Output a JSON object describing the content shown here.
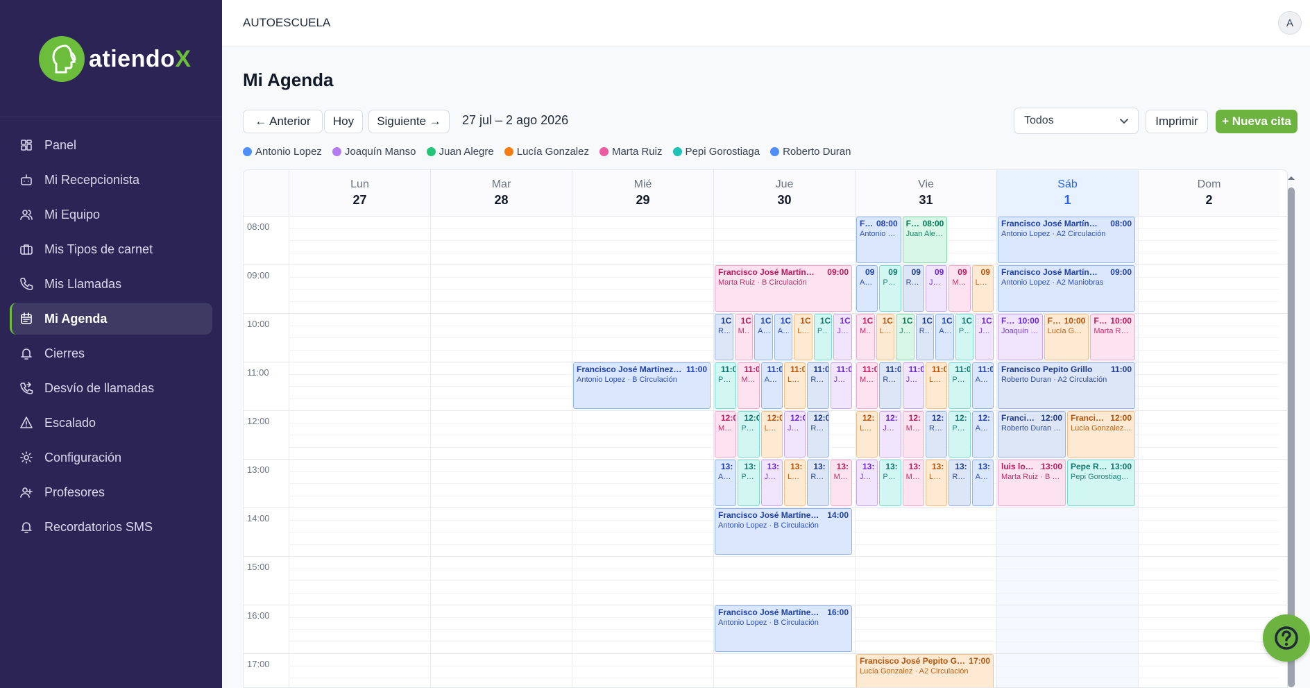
{
  "brand": {
    "name": "atiendo",
    "x": "X",
    "color": "#6cbd3c"
  },
  "sidebar": {
    "items": [
      {
        "label": "Panel",
        "icon": "dashboard-icon"
      },
      {
        "label": "Mi Recepcionista",
        "icon": "robot-icon"
      },
      {
        "label": "Mi Equipo",
        "icon": "users-icon"
      },
      {
        "label": "Mis Tipos de carnet",
        "icon": "briefcase-icon"
      },
      {
        "label": "Mis Llamadas",
        "icon": "phone-icon"
      },
      {
        "label": "Mi Agenda",
        "icon": "calendar-icon",
        "active": true
      },
      {
        "label": "Cierres",
        "icon": "bell-icon"
      },
      {
        "label": "Desvío de llamadas",
        "icon": "phone-forward-icon"
      },
      {
        "label": "Escalado",
        "icon": "warning-icon"
      },
      {
        "label": "Configuración",
        "icon": "gear-icon"
      },
      {
        "label": "Profesores",
        "icon": "user-plus-icon"
      },
      {
        "label": "Recordatorios SMS",
        "icon": "bell-icon"
      }
    ]
  },
  "topbar": {
    "title": "AUTOESCUELA",
    "avatar": "A"
  },
  "page": {
    "title": "Mi Agenda"
  },
  "toolbar": {
    "prev": "← Anterior",
    "today": "Hoy",
    "next": "Siguiente →",
    "range": "27 jul – 2 ago 2026",
    "filter": "Todos",
    "print": "Imprimir",
    "new": "+ Nueva cita"
  },
  "legend": [
    {
      "name": "Antonio Lopez",
      "color": "#4f8ef7"
    },
    {
      "name": "Joaquín Manso",
      "color": "#b57bf0"
    },
    {
      "name": "Juan Alegre",
      "color": "#22c57a"
    },
    {
      "name": "Lucía Gonzalez",
      "color": "#f47c13"
    },
    {
      "name": "Marta Ruiz",
      "color": "#ec5ba2"
    },
    {
      "name": "Pepi Gorostiaga",
      "color": "#1ec2b4"
    },
    {
      "name": "Roberto Duran",
      "color": "#4f8ef7"
    }
  ],
  "teacher_colors": {
    "AL": {
      "bg": "#dbe7fd",
      "bd": "#8fb4f4",
      "tx": "#1e40af"
    },
    "JM": {
      "bg": "#f0e5fd",
      "bd": "#c9a6f3",
      "tx": "#6d28d9"
    },
    "JA": {
      "bg": "#d8f7e6",
      "bd": "#7fdcab",
      "tx": "#047857"
    },
    "LG": {
      "bg": "#feead3",
      "bd": "#f6bd85",
      "tx": "#b45309"
    },
    "MR": {
      "bg": "#fde2ef",
      "bd": "#f3a7cd",
      "tx": "#be185d"
    },
    "PG": {
      "bg": "#d2f6f1",
      "bd": "#76dccf",
      "tx": "#0f766e"
    },
    "RD": {
      "bg": "#dde6f7",
      "bd": "#9cb3e2",
      "tx": "#1e3a8a"
    }
  },
  "calendar": {
    "days": [
      {
        "name": "Lun",
        "num": "27"
      },
      {
        "name": "Mar",
        "num": "28"
      },
      {
        "name": "Mié",
        "num": "29"
      },
      {
        "name": "Jue",
        "num": "30"
      },
      {
        "name": "Vie",
        "num": "31"
      },
      {
        "name": "Sáb",
        "num": "1",
        "today": true
      },
      {
        "name": "Dom",
        "num": "2"
      }
    ],
    "hours": [
      "08:00",
      "09:00",
      "10:00",
      "11:00",
      "12:00",
      "13:00",
      "14:00",
      "15:00",
      "16:00",
      "17:00"
    ],
    "events": [
      {
        "day": 4,
        "start": 8,
        "dur": 1,
        "col": 0,
        "ncol": 3,
        "t": "AL",
        "title": "Franci…",
        "time": "08:00",
        "sub": "Antonio Lopez ·…"
      },
      {
        "day": 4,
        "start": 8,
        "dur": 1,
        "col": 1,
        "ncol": 3,
        "t": "JA",
        "title": "Franci…",
        "time": "08:00",
        "sub": "Juan Alegre · A…"
      },
      {
        "day": 5,
        "start": 8,
        "dur": 1,
        "col": 0,
        "ncol": 1,
        "t": "AL",
        "title": "Francisco José Martín…",
        "time": "08:00",
        "sub": "Antonio Lopez · A2 Circulación"
      },
      {
        "day": 3,
        "start": 9,
        "dur": 1,
        "col": 0,
        "ncol": 1,
        "t": "MR",
        "title": "Francisco José Martín…",
        "time": "09:00",
        "sub": "Marta Ruiz · B Circulación"
      },
      {
        "day": 4,
        "start": 9,
        "dur": 1,
        "col": 0,
        "ncol": 6,
        "t": "AL",
        "title": "",
        "time": "09",
        "sub": "A…"
      },
      {
        "day": 4,
        "start": 9,
        "dur": 1,
        "col": 1,
        "ncol": 6,
        "t": "PG",
        "title": "",
        "time": "09",
        "sub": "Pe…"
      },
      {
        "day": 4,
        "start": 9,
        "dur": 1,
        "col": 2,
        "ncol": 6,
        "t": "RD",
        "title": "",
        "time": "09",
        "sub": "Ro…"
      },
      {
        "day": 4,
        "start": 9,
        "dur": 1,
        "col": 3,
        "ncol": 6,
        "t": "JM",
        "title": "",
        "time": "09",
        "sub": "Jo…"
      },
      {
        "day": 4,
        "start": 9,
        "dur": 1,
        "col": 4,
        "ncol": 6,
        "t": "MR",
        "title": "",
        "time": "09",
        "sub": "M…"
      },
      {
        "day": 4,
        "start": 9,
        "dur": 1,
        "col": 5,
        "ncol": 6,
        "t": "LG",
        "title": "",
        "time": "09",
        "sub": "Lu…"
      },
      {
        "day": 5,
        "start": 9,
        "dur": 1,
        "col": 0,
        "ncol": 1,
        "t": "AL",
        "title": "Francisco José Martín…",
        "time": "09:00",
        "sub": "Antonio Lopez · A2 Maniobras"
      },
      {
        "day": 3,
        "start": 10,
        "dur": 1,
        "col": 0,
        "ncol": 7,
        "t": "RD",
        "title": "",
        "time": "1C",
        "sub": "R…"
      },
      {
        "day": 3,
        "start": 10,
        "dur": 1,
        "col": 1,
        "ncol": 7,
        "t": "MR",
        "title": "",
        "time": "1C",
        "sub": "M…"
      },
      {
        "day": 3,
        "start": 10,
        "dur": 1,
        "col": 2,
        "ncol": 7,
        "t": "AL",
        "title": "",
        "time": "1C",
        "sub": "A…"
      },
      {
        "day": 3,
        "start": 10,
        "dur": 1,
        "col": 3,
        "ncol": 7,
        "t": "AL",
        "title": "",
        "time": "1C",
        "sub": "A…"
      },
      {
        "day": 3,
        "start": 10,
        "dur": 1,
        "col": 4,
        "ncol": 7,
        "t": "LG",
        "title": "",
        "time": "1C",
        "sub": "L…"
      },
      {
        "day": 3,
        "start": 10,
        "dur": 1,
        "col": 5,
        "ncol": 7,
        "t": "PG",
        "title": "",
        "time": "1C",
        "sub": "P…"
      },
      {
        "day": 3,
        "start": 10,
        "dur": 1,
        "col": 6,
        "ncol": 7,
        "t": "JM",
        "title": "",
        "time": "1C",
        "sub": "J…"
      },
      {
        "day": 4,
        "start": 10,
        "dur": 1,
        "col": 0,
        "ncol": 7,
        "t": "MR",
        "title": "",
        "time": "1C",
        "sub": "M…"
      },
      {
        "day": 4,
        "start": 10,
        "dur": 1,
        "col": 1,
        "ncol": 7,
        "t": "LG",
        "title": "",
        "time": "1C",
        "sub": "L…"
      },
      {
        "day": 4,
        "start": 10,
        "dur": 1,
        "col": 2,
        "ncol": 7,
        "t": "JA",
        "title": "",
        "time": "1C",
        "sub": "J…"
      },
      {
        "day": 4,
        "start": 10,
        "dur": 1,
        "col": 3,
        "ncol": 7,
        "t": "RD",
        "title": "",
        "time": "1C",
        "sub": "R…"
      },
      {
        "day": 4,
        "start": 10,
        "dur": 1,
        "col": 4,
        "ncol": 7,
        "t": "AL",
        "title": "",
        "time": "1C",
        "sub": "A…"
      },
      {
        "day": 4,
        "start": 10,
        "dur": 1,
        "col": 5,
        "ncol": 7,
        "t": "PG",
        "title": "",
        "time": "1C",
        "sub": "P…"
      },
      {
        "day": 4,
        "start": 10,
        "dur": 1,
        "col": 6,
        "ncol": 7,
        "t": "JM",
        "title": "",
        "time": "1C",
        "sub": "J…"
      },
      {
        "day": 5,
        "start": 10,
        "dur": 1,
        "col": 0,
        "ncol": 3,
        "t": "JM",
        "title": "F…",
        "time": "10:00",
        "sub": "Joaquín …"
      },
      {
        "day": 5,
        "start": 10,
        "dur": 1,
        "col": 1,
        "ncol": 3,
        "t": "LG",
        "title": "F…",
        "time": "10:00",
        "sub": "Lucía Go…"
      },
      {
        "day": 5,
        "start": 10,
        "dur": 1,
        "col": 2,
        "ncol": 3,
        "t": "MR",
        "title": "F…",
        "time": "10:00",
        "sub": "Marta Ru…"
      },
      {
        "day": 2,
        "start": 11,
        "dur": 1,
        "col": 0,
        "ncol": 1,
        "t": "AL",
        "title": "Francisco José Martínez…",
        "time": "11:00",
        "sub": "Antonio Lopez · B Circulación"
      },
      {
        "day": 3,
        "start": 11,
        "dur": 1,
        "col": 0,
        "ncol": 6,
        "t": "PG",
        "title": "",
        "time": "11:0",
        "sub": "Pe…"
      },
      {
        "day": 3,
        "start": 11,
        "dur": 1,
        "col": 1,
        "ncol": 6,
        "t": "MR",
        "title": "",
        "time": "11:0",
        "sub": "M…"
      },
      {
        "day": 3,
        "start": 11,
        "dur": 1,
        "col": 2,
        "ncol": 6,
        "t": "AL",
        "title": "",
        "time": "11:0",
        "sub": "A…"
      },
      {
        "day": 3,
        "start": 11,
        "dur": 1,
        "col": 3,
        "ncol": 6,
        "t": "LG",
        "title": "",
        "time": "11:0",
        "sub": "Lu…"
      },
      {
        "day": 3,
        "start": 11,
        "dur": 1,
        "col": 4,
        "ncol": 6,
        "t": "RD",
        "title": "",
        "time": "11:0",
        "sub": "Ro…"
      },
      {
        "day": 3,
        "start": 11,
        "dur": 1,
        "col": 5,
        "ncol": 6,
        "t": "JM",
        "title": "",
        "time": "11:0",
        "sub": "Jo…"
      },
      {
        "day": 4,
        "start": 11,
        "dur": 1,
        "col": 0,
        "ncol": 6,
        "t": "MR",
        "title": "",
        "time": "11:0",
        "sub": "M…"
      },
      {
        "day": 4,
        "start": 11,
        "dur": 1,
        "col": 1,
        "ncol": 6,
        "t": "RD",
        "title": "",
        "time": "11:0",
        "sub": "Ro…"
      },
      {
        "day": 4,
        "start": 11,
        "dur": 1,
        "col": 2,
        "ncol": 6,
        "t": "JM",
        "title": "",
        "time": "11:0",
        "sub": "Jo…"
      },
      {
        "day": 4,
        "start": 11,
        "dur": 1,
        "col": 3,
        "ncol": 6,
        "t": "LG",
        "title": "",
        "time": "11:0",
        "sub": "Lu…"
      },
      {
        "day": 4,
        "start": 11,
        "dur": 1,
        "col": 4,
        "ncol": 6,
        "t": "PG",
        "title": "",
        "time": "11:0",
        "sub": "Pe…"
      },
      {
        "day": 4,
        "start": 11,
        "dur": 1,
        "col": 5,
        "ncol": 6,
        "t": "AL",
        "title": "",
        "time": "11:0",
        "sub": "A…"
      },
      {
        "day": 5,
        "start": 11,
        "dur": 1,
        "col": 0,
        "ncol": 1,
        "t": "RD",
        "title": "Francisco Pepito Grillo",
        "time": "11:00",
        "sub": "Roberto Duran · A2 Circulación"
      },
      {
        "day": 3,
        "start": 12,
        "dur": 1,
        "col": 0,
        "ncol": 6,
        "t": "MR",
        "title": "",
        "time": "12:0",
        "sub": "Mar…"
      },
      {
        "day": 3,
        "start": 12,
        "dur": 1,
        "col": 1,
        "ncol": 6,
        "t": "PG",
        "title": "",
        "time": "12:C",
        "sub": "Pep…"
      },
      {
        "day": 3,
        "start": 12,
        "dur": 1,
        "col": 2,
        "ncol": 6,
        "t": "LG",
        "title": "",
        "time": "12:0",
        "sub": "Luc…"
      },
      {
        "day": 3,
        "start": 12,
        "dur": 1,
        "col": 3,
        "ncol": 6,
        "t": "JM",
        "title": "",
        "time": "12:C",
        "sub": "Joa…"
      },
      {
        "day": 3,
        "start": 12,
        "dur": 1,
        "col": 4,
        "ncol": 6,
        "t": "RD",
        "title": "",
        "time": "12:0",
        "sub": "Ro…"
      },
      {
        "day": 4,
        "start": 12,
        "dur": 1,
        "col": 0,
        "ncol": 6,
        "t": "LG",
        "title": "",
        "time": "12:",
        "sub": "Lu…"
      },
      {
        "day": 4,
        "start": 12,
        "dur": 1,
        "col": 1,
        "ncol": 6,
        "t": "JM",
        "title": "",
        "time": "12:",
        "sub": "Jo…"
      },
      {
        "day": 4,
        "start": 12,
        "dur": 1,
        "col": 2,
        "ncol": 6,
        "t": "MR",
        "title": "",
        "time": "12:",
        "sub": "M…"
      },
      {
        "day": 4,
        "start": 12,
        "dur": 1,
        "col": 3,
        "ncol": 6,
        "t": "RD",
        "title": "",
        "time": "12:",
        "sub": "Ro…"
      },
      {
        "day": 4,
        "start": 12,
        "dur": 1,
        "col": 4,
        "ncol": 6,
        "t": "PG",
        "title": "",
        "time": "12:",
        "sub": "Pe…"
      },
      {
        "day": 4,
        "start": 12,
        "dur": 1,
        "col": 5,
        "ncol": 6,
        "t": "AL",
        "title": "",
        "time": "12:",
        "sub": "A…"
      },
      {
        "day": 5,
        "start": 12,
        "dur": 1,
        "col": 0,
        "ncol": 2,
        "t": "RD",
        "title": "Franci…",
        "time": "12:00",
        "sub": "Roberto Duran ·…"
      },
      {
        "day": 5,
        "start": 12,
        "dur": 1,
        "col": 1,
        "ncol": 2,
        "t": "LG",
        "title": "Franci…",
        "time": "12:00",
        "sub": "Lucía Gonzalez …"
      },
      {
        "day": 3,
        "start": 13,
        "dur": 1,
        "col": 0,
        "ncol": 6,
        "t": "AL",
        "title": "",
        "time": "13:",
        "sub": "A…"
      },
      {
        "day": 3,
        "start": 13,
        "dur": 1,
        "col": 1,
        "ncol": 6,
        "t": "PG",
        "title": "",
        "time": "13:",
        "sub": "Pe…"
      },
      {
        "day": 3,
        "start": 13,
        "dur": 1,
        "col": 2,
        "ncol": 6,
        "t": "JM",
        "title": "",
        "time": "13:",
        "sub": "Jo…"
      },
      {
        "day": 3,
        "start": 13,
        "dur": 1,
        "col": 3,
        "ncol": 6,
        "t": "LG",
        "title": "",
        "time": "13:",
        "sub": "Lu…"
      },
      {
        "day": 3,
        "start": 13,
        "dur": 1,
        "col": 4,
        "ncol": 6,
        "t": "RD",
        "title": "",
        "time": "13:",
        "sub": "Ro…"
      },
      {
        "day": 3,
        "start": 13,
        "dur": 1,
        "col": 5,
        "ncol": 6,
        "t": "MR",
        "title": "",
        "time": "13:",
        "sub": "M…"
      },
      {
        "day": 4,
        "start": 13,
        "dur": 1,
        "col": 0,
        "ncol": 6,
        "t": "JM",
        "title": "",
        "time": "13:",
        "sub": "Jo…"
      },
      {
        "day": 4,
        "start": 13,
        "dur": 1,
        "col": 1,
        "ncol": 6,
        "t": "PG",
        "title": "",
        "time": "13:",
        "sub": "Pe…"
      },
      {
        "day": 4,
        "start": 13,
        "dur": 1,
        "col": 2,
        "ncol": 6,
        "t": "MR",
        "title": "",
        "time": "13:",
        "sub": "M…"
      },
      {
        "day": 4,
        "start": 13,
        "dur": 1,
        "col": 3,
        "ncol": 6,
        "t": "LG",
        "title": "",
        "time": "13:",
        "sub": "Lu…"
      },
      {
        "day": 4,
        "start": 13,
        "dur": 1,
        "col": 4,
        "ncol": 6,
        "t": "RD",
        "title": "",
        "time": "13:",
        "sub": "Ro…"
      },
      {
        "day": 4,
        "start": 13,
        "dur": 1,
        "col": 5,
        "ncol": 6,
        "t": "AL",
        "title": "",
        "time": "13:",
        "sub": "A…"
      },
      {
        "day": 5,
        "start": 13,
        "dur": 1,
        "col": 0,
        "ncol": 2,
        "t": "MR",
        "title": "luis lo…",
        "time": "13:00",
        "sub": "Marta Ruiz · B C…"
      },
      {
        "day": 5,
        "start": 13,
        "dur": 1,
        "col": 1,
        "ncol": 2,
        "t": "PG",
        "title": "Pepe R…",
        "time": "13:00",
        "sub": "Pepi Gorostiag…"
      },
      {
        "day": 3,
        "start": 14,
        "dur": 1,
        "col": 0,
        "ncol": 1,
        "t": "AL",
        "title": "Francisco José Martíne…",
        "time": "14:00",
        "sub": "Antonio Lopez · B Circulación"
      },
      {
        "day": 3,
        "start": 16,
        "dur": 1,
        "col": 0,
        "ncol": 1,
        "t": "AL",
        "title": "Francisco José Martíne…",
        "time": "16:00",
        "sub": "Antonio Lopez · B Circulación"
      },
      {
        "day": 4,
        "start": 17,
        "dur": 1,
        "col": 0,
        "ncol": 1,
        "t": "LG",
        "title": "Francisco José Pepito G…",
        "time": "17:00",
        "sub": "Lucía Gonzalez · A2 Circulación"
      }
    ]
  }
}
